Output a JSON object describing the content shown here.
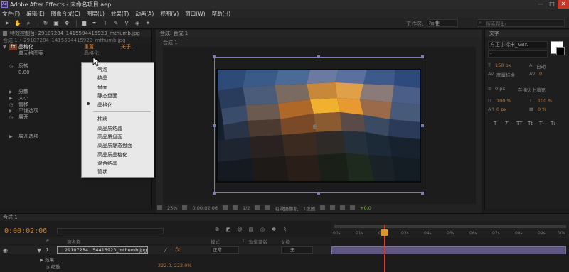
{
  "window": {
    "app_icon": "Ae",
    "title": "Adobe After Effects - 未命名项目.aep",
    "controls": [
      "—",
      "□",
      "✕"
    ]
  },
  "menu": [
    "文件(F)",
    "编辑(E)",
    "图像合成(C)",
    "图层(L)",
    "效果(T)",
    "动画(A)",
    "视图(V)",
    "窗口(W)",
    "帮助(H)"
  ],
  "toolbar": {
    "tools": [
      "hand-tool-icon",
      "zoom-tool-icon",
      "rotate-tool-icon",
      "camera-tool-icon",
      "pan-tool-icon",
      "rectangle-tool-icon",
      "pen-tool-icon",
      "text-tool-icon",
      "brush-tool-icon",
      "clone-tool-icon",
      "eraser-tool-icon",
      "puppet-tool-icon"
    ],
    "workspace_label": "工作区:",
    "workspace_value": "标准",
    "search_placeholder": "搜索帮助"
  },
  "effect_controls": {
    "tab_label": "特效控制台: 29107284_1415594415923_mthumb.jpg",
    "subtitle": "合成 1 • 29107284_1415594415923_mthumb.jpg",
    "effect_name": "晶格化",
    "reset_label": "重置",
    "about_label": "关于...",
    "rows": [
      {
        "label": "单元格图案",
        "value": "晶格化"
      },
      {
        "label": "反转",
        "value": ""
      },
      {
        "label": "0.00",
        "value": ""
      },
      {
        "label": "分散",
        "value": ""
      },
      {
        "label": "大小",
        "value": ""
      },
      {
        "label": "偏移",
        "value": ""
      },
      {
        "label": "平铺选项",
        "value": ""
      },
      {
        "label": "展开",
        "value": ""
      },
      {
        "label": "展开选项",
        "value": ""
      }
    ]
  },
  "dropdown": {
    "items_group1": [
      "气泡",
      "结晶",
      "盘面",
      "静态盘面",
      "晶格化"
    ],
    "items_group2": [
      "枕状",
      "高品质结晶",
      "高品质盘面",
      "高品质静态盘面",
      "高品质晶格化",
      "混合结晶",
      "管状"
    ],
    "selected": "晶格化"
  },
  "composition": {
    "tab_label": "合成: 合成 1",
    "breadcrumb": "合成 1",
    "controls": [
      "25%",
      "0:00:02:06",
      "1/2",
      "有效摄像机",
      "1视图",
      "+0.0"
    ]
  },
  "character_panel": {
    "tab_label": "文字",
    "font_name": "方正小标宋_GBK",
    "font_style": "-",
    "size": "150 px",
    "leading": "自动",
    "kerning": "度量标准",
    "tracking": "0",
    "stroke_width": "0 px",
    "stroke_type": "在描边上填充",
    "vscale": "100 %",
    "hscale": "100 %",
    "baseline": "0 px",
    "tsume": "0 %",
    "style_buttons": [
      "T",
      "T",
      "TT",
      "Tt",
      "T¹",
      "T₁"
    ]
  },
  "timeline": {
    "tab_label": "合成 1",
    "timecode": "0:00:02:06",
    "columns": [
      "#",
      "源名称",
      "模式",
      "T",
      "轨道蒙版",
      "父级"
    ],
    "layer": {
      "number": "1",
      "name": "29107284...54415923_mthumb.jpg",
      "mode": "正常",
      "parent": "无"
    },
    "sub_rows": [
      {
        "label": "效果",
        "value": ""
      },
      {
        "label": "缩放",
        "value": "222.0, 222.0%"
      }
    ],
    "ruler_ticks": [
      "00s",
      "01s",
      "02s",
      "03s",
      "04s",
      "05s",
      "06s",
      "07s",
      "08s",
      "09s",
      "10s"
    ],
    "playhead_position": "0:00:02:06"
  },
  "colors": {
    "accent_orange": "#d2801e",
    "selection_purple": "#7b7bb5",
    "playhead_red": "#d83a2a"
  }
}
